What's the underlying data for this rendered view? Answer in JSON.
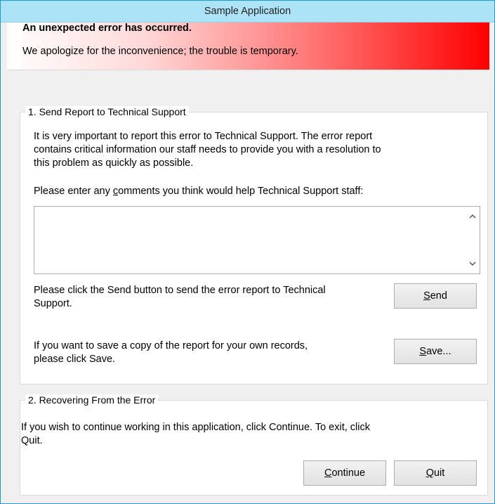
{
  "window": {
    "title": "Sample Application"
  },
  "banner": {
    "title": "An unexpected error has occurred.",
    "message": "We apologize for the inconvenience; the trouble is temporary."
  },
  "section1": {
    "legend": "1. Send Report to Technical Support",
    "intro_lines": [
      "It is very important to report this error to Technical Support. The error report",
      "contains critical information our staff needs to provide you with a resolution to",
      "this problem as quickly as possible."
    ],
    "comments_prompt_pre": "Please enter any ",
    "comments_prompt_u": "c",
    "comments_prompt_post": "omments you think would help Technical Support staff:",
    "comments_value": "",
    "send_text_lines": [
      "Please click the Send button to send the error report to Technical",
      "Support."
    ],
    "send_button": {
      "u": "S",
      "rest": "end"
    },
    "save_text_lines": [
      "If you want to save a copy of the report for your own records,",
      "please click Save."
    ],
    "save_button": {
      "u": "S",
      "rest": "ave..."
    }
  },
  "section2": {
    "legend": "2. Recovering From the Error",
    "text_lines": [
      "If you wish to continue working in this application, click Continue. To exit, click",
      "Quit."
    ],
    "continue_button": {
      "u": "C",
      "rest": "ontinue"
    },
    "quit_button": {
      "u": "Q",
      "rest": "uit"
    }
  },
  "icons": {
    "scroll_up": "chevron-up-icon",
    "scroll_down": "chevron-down-icon"
  }
}
